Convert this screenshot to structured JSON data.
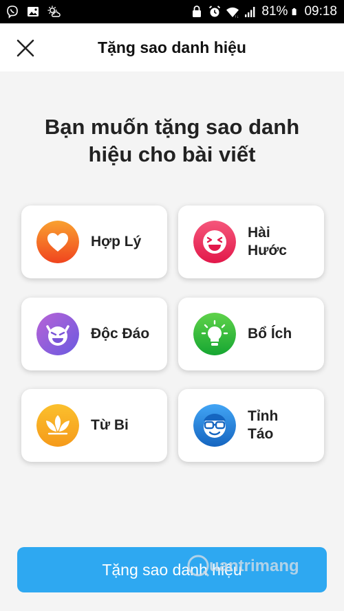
{
  "status_bar": {
    "battery_percent": "81%",
    "time": "09:18",
    "icons": [
      "viber-icon",
      "gallery-icon",
      "weather-icon",
      "lock-icon",
      "alarm-icon",
      "wifi-icon",
      "signal-icon",
      "battery-icon"
    ]
  },
  "header": {
    "title": "Tặng sao danh hiệu",
    "close_icon": "close-icon"
  },
  "question": {
    "line1": "Bạn muốn tặng sao danh",
    "line2": "hiệu cho bài viết"
  },
  "options": [
    {
      "line1": "Hợp Lý",
      "line2": "",
      "icon": "heart-icon",
      "color": "#f4511e"
    },
    {
      "line1": "Hài",
      "line2": "Hước",
      "icon": "laughing-face-icon",
      "color": "#ec2e63"
    },
    {
      "line1": "Độc Đáo",
      "line2": "",
      "icon": "devil-face-icon",
      "color": "#8f5bd6"
    },
    {
      "line1": "Bổ Ích",
      "line2": "",
      "icon": "lightbulb-icon",
      "color": "#2bbd3c"
    },
    {
      "line1": "Từ Bi",
      "line2": "",
      "icon": "lotus-icon",
      "color": "#f7a41f"
    },
    {
      "line1": "Tỉnh",
      "line2": "Táo",
      "icon": "glasses-face-icon",
      "color": "#1e88e5"
    }
  ],
  "submit": {
    "label": "Tặng sao danh hiệu",
    "color": "#2ea8f1"
  },
  "watermark": "uantrimang"
}
